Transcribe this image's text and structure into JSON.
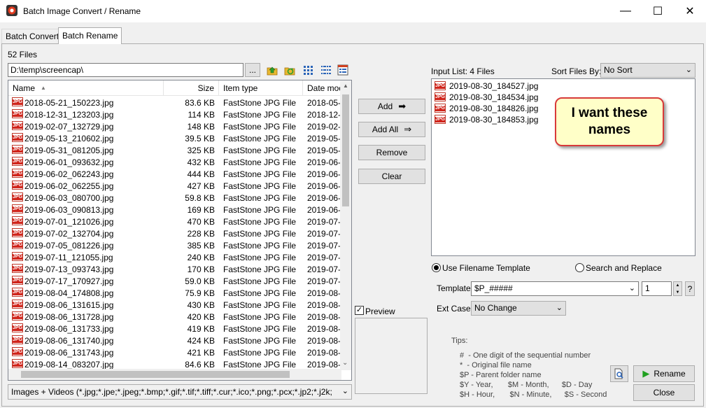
{
  "window": {
    "title": "Batch Image Convert / Rename",
    "minimize_glyph": "—",
    "maximize_glyph": "☐",
    "close_glyph": "✕"
  },
  "tabs": [
    {
      "label": "Batch Convert",
      "active": false
    },
    {
      "label": "Batch Rename",
      "active": true
    }
  ],
  "browser": {
    "file_count": "52 Files",
    "path": "D:\\temp\\screencap\\",
    "browse_label": "...",
    "columns": {
      "name": "Name",
      "size": "Size",
      "type": "Item type",
      "date": "Date mod"
    },
    "files": [
      {
        "name": "2018-05-21_150223.jpg",
        "size": "83.6 KB",
        "type": "FastStone JPG File",
        "date": "2018-05-"
      },
      {
        "name": "2018-12-31_123203.jpg",
        "size": "114 KB",
        "type": "FastStone JPG File",
        "date": "2018-12-"
      },
      {
        "name": "2019-02-07_132729.jpg",
        "size": "148 KB",
        "type": "FastStone JPG File",
        "date": "2019-02-"
      },
      {
        "name": "2019-05-13_210602.jpg",
        "size": "39.5 KB",
        "type": "FastStone JPG File",
        "date": "2019-05-"
      },
      {
        "name": "2019-05-31_081205.jpg",
        "size": "325 KB",
        "type": "FastStone JPG File",
        "date": "2019-05-"
      },
      {
        "name": "2019-06-01_093632.jpg",
        "size": "432 KB",
        "type": "FastStone JPG File",
        "date": "2019-06-"
      },
      {
        "name": "2019-06-02_062243.jpg",
        "size": "444 KB",
        "type": "FastStone JPG File",
        "date": "2019-06-"
      },
      {
        "name": "2019-06-02_062255.jpg",
        "size": "427 KB",
        "type": "FastStone JPG File",
        "date": "2019-06-"
      },
      {
        "name": "2019-06-03_080700.jpg",
        "size": "59.8 KB",
        "type": "FastStone JPG File",
        "date": "2019-06-"
      },
      {
        "name": "2019-06-03_090813.jpg",
        "size": "169 KB",
        "type": "FastStone JPG File",
        "date": "2019-06-"
      },
      {
        "name": "2019-07-01_121026.jpg",
        "size": "470 KB",
        "type": "FastStone JPG File",
        "date": "2019-07-"
      },
      {
        "name": "2019-07-02_132704.jpg",
        "size": "228 KB",
        "type": "FastStone JPG File",
        "date": "2019-07-"
      },
      {
        "name": "2019-07-05_081226.jpg",
        "size": "385 KB",
        "type": "FastStone JPG File",
        "date": "2019-07-"
      },
      {
        "name": "2019-07-11_121055.jpg",
        "size": "240 KB",
        "type": "FastStone JPG File",
        "date": "2019-07-"
      },
      {
        "name": "2019-07-13_093743.jpg",
        "size": "170 KB",
        "type": "FastStone JPG File",
        "date": "2019-07-"
      },
      {
        "name": "2019-07-17_170927.jpg",
        "size": "59.0 KB",
        "type": "FastStone JPG File",
        "date": "2019-07-"
      },
      {
        "name": "2019-08-04_174808.jpg",
        "size": "75.9 KB",
        "type": "FastStone JPG File",
        "date": "2019-08-"
      },
      {
        "name": "2019-08-06_131615.jpg",
        "size": "430 KB",
        "type": "FastStone JPG File",
        "date": "2019-08-"
      },
      {
        "name": "2019-08-06_131728.jpg",
        "size": "420 KB",
        "type": "FastStone JPG File",
        "date": "2019-08-"
      },
      {
        "name": "2019-08-06_131733.jpg",
        "size": "419 KB",
        "type": "FastStone JPG File",
        "date": "2019-08-"
      },
      {
        "name": "2019-08-06_131740.jpg",
        "size": "424 KB",
        "type": "FastStone JPG File",
        "date": "2019-08-"
      },
      {
        "name": "2019-08-06_131743.jpg",
        "size": "421 KB",
        "type": "FastStone JPG File",
        "date": "2019-08-"
      },
      {
        "name": "2019-08-14_083207.jpg",
        "size": "84.6 KB",
        "type": "FastStone JPG File",
        "date": "2019-08-"
      }
    ],
    "filter": "Images + Videos (*.jpg;*.jpe;*.jpeg;*.bmp;*.gif;*.tif;*.tiff;*.cur;*.ico;*.png;*.pcx;*.jp2;*.j2k;"
  },
  "actions": {
    "add": "Add",
    "add_all": "Add All",
    "remove": "Remove",
    "clear": "Clear",
    "preview": "Preview"
  },
  "input_list": {
    "label": "Input List:  4 Files",
    "sort_label": "Sort Files By:",
    "sort_value": "No Sort",
    "files": [
      "2019-08-30_184527.jpg",
      "2019-08-30_184534.jpg",
      "2019-08-30_184826.jpg",
      "2019-08-30_184853.jpg"
    ],
    "callout_line1": "I want these",
    "callout_line2": "names"
  },
  "rename": {
    "mode_template": "Use Filename Template",
    "mode_search": "Search and Replace",
    "template_label": "Template:",
    "template_value": "$P_#####",
    "start_number": "1",
    "help": "?",
    "ext_label": "Ext Case:",
    "ext_value": "No Change",
    "tips_title": "Tips:",
    "tips": [
      "#  - One digit of the sequential number",
      "*  - Original file name",
      "$P - Parent folder name",
      "$Y - Year,       $M - Month,      $D - Day",
      "$H - Hour,       $N - Minute,      $S - Second"
    ],
    "rename_button": "Rename",
    "close_button": "Close"
  }
}
